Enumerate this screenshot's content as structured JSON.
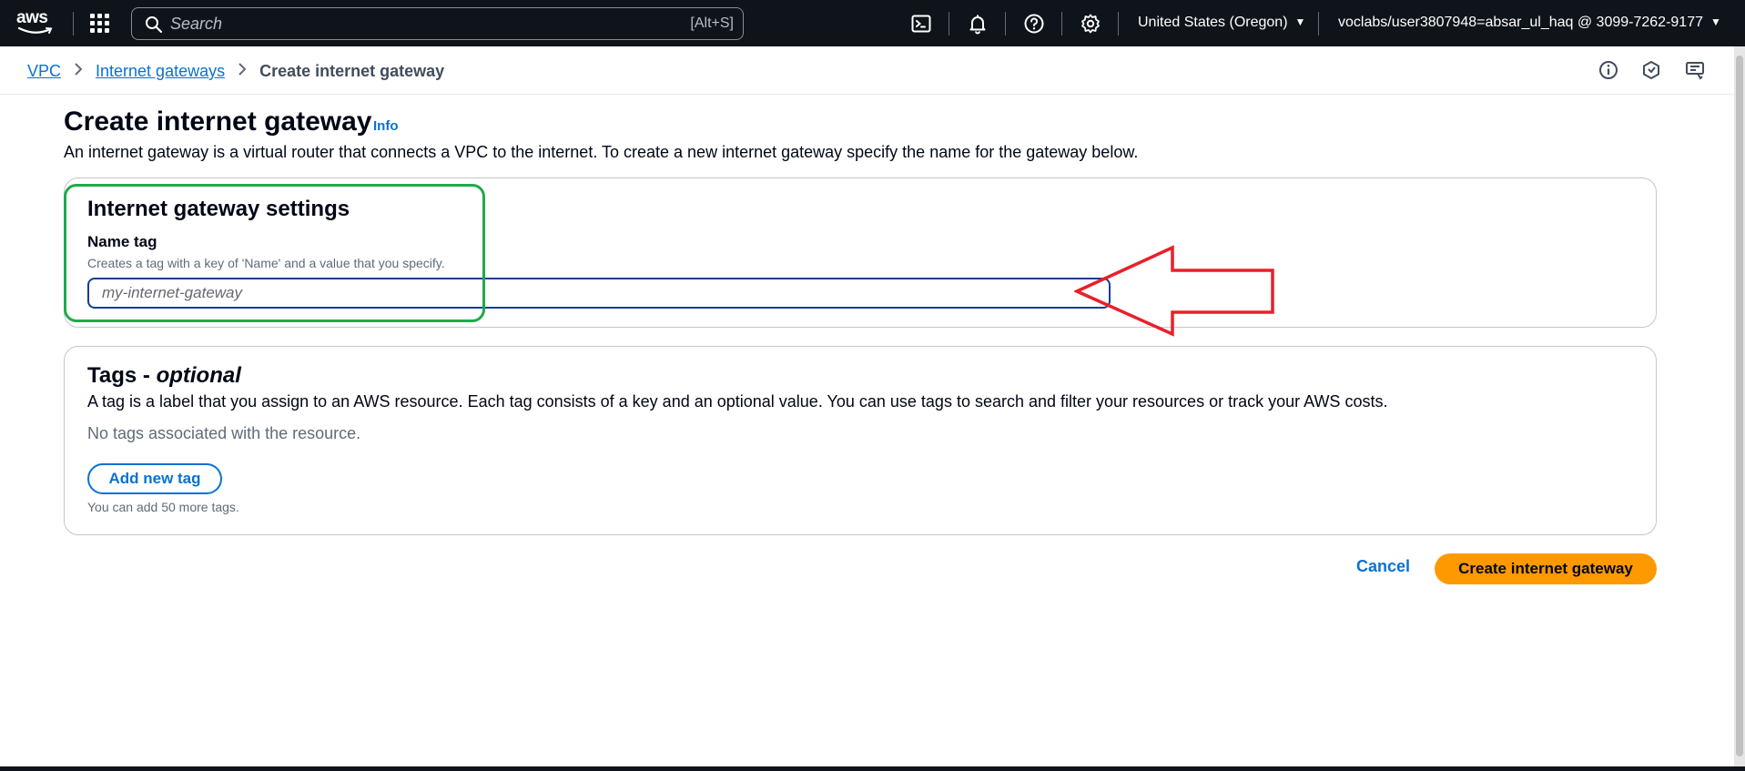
{
  "topnav": {
    "logo_text": "aws",
    "search_placeholder": "Search",
    "search_shortcut": "[Alt+S]",
    "region": "United States (Oregon)",
    "account": "voclabs/user3807948=absar_ul_haq @ 3099-7262-9177"
  },
  "breadcrumb": {
    "items": [
      "VPC",
      "Internet gateways"
    ],
    "current": "Create internet gateway"
  },
  "page": {
    "title": "Create internet gateway",
    "info": "Info",
    "description": "An internet gateway is a virtual router that connects a VPC to the internet. To create a new internet gateway specify the name for the gateway below."
  },
  "settings": {
    "heading": "Internet gateway settings",
    "name_label": "Name tag",
    "name_desc": "Creates a tag with a key of 'Name' and a value that you specify.",
    "name_placeholder": "my-internet-gateway",
    "name_value": ""
  },
  "tags": {
    "heading_prefix": "Tags - ",
    "heading_optional": "optional",
    "description": "A tag is a label that you assign to an AWS resource. Each tag consists of a key and an optional value. You can use tags to search and filter your resources or track your AWS costs.",
    "empty_text": "No tags associated with the resource.",
    "add_button": "Add new tag",
    "limit_text": "You can add 50 more tags."
  },
  "actions": {
    "cancel": "Cancel",
    "create": "Create internet gateway"
  },
  "colors": {
    "nav_bg": "#0f141a",
    "link": "#0972d3",
    "primary_button": "#ff9900",
    "annotation_box": "#1faa4b",
    "annotation_arrow": "#e8202a"
  },
  "icons": [
    "apps-grid-icon",
    "search-icon",
    "cloudshell-icon",
    "bell-icon",
    "help-icon",
    "gear-icon",
    "info-icon",
    "feedback-icon",
    "notifications-tool-icon"
  ]
}
